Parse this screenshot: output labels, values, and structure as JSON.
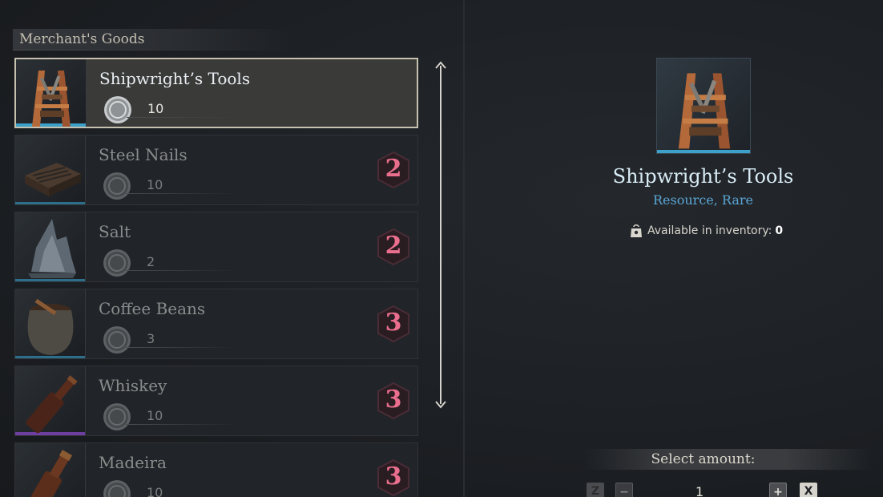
{
  "left_panel": {
    "title": "Merchant's Goods",
    "items": [
      {
        "name": "Shipwright’s Tools",
        "price": "10",
        "rank": "",
        "selected": true
      },
      {
        "name": "Steel Nails",
        "price": "10",
        "rank": "2"
      },
      {
        "name": "Salt",
        "price": "2",
        "rank": "2"
      },
      {
        "name": "Coffee Beans",
        "price": "3",
        "rank": "3"
      },
      {
        "name": "Whiskey",
        "price": "10",
        "rank": "3"
      },
      {
        "name": "Madeira",
        "price": "10",
        "rank": "3"
      }
    ]
  },
  "detail": {
    "title": "Shipwright’s Tools",
    "subtitle": "Resource, Rare",
    "inventory_label": "Available in inventory:",
    "inventory_value": "0",
    "select_amount_label": "Select amount:",
    "amount": "1",
    "keys": {
      "decrease_key": "Z",
      "minus": "−",
      "plus": "+",
      "increase_key": "X"
    }
  },
  "colors": {
    "accent_blue": "#3da0c8",
    "rank_pink": "#ea6f8e",
    "rarity_blue": "#5aa6d6"
  },
  "icons": [
    "coin-icon",
    "bag-icon",
    "scroll-up-arrow-icon",
    "scroll-down-arrow-icon"
  ]
}
